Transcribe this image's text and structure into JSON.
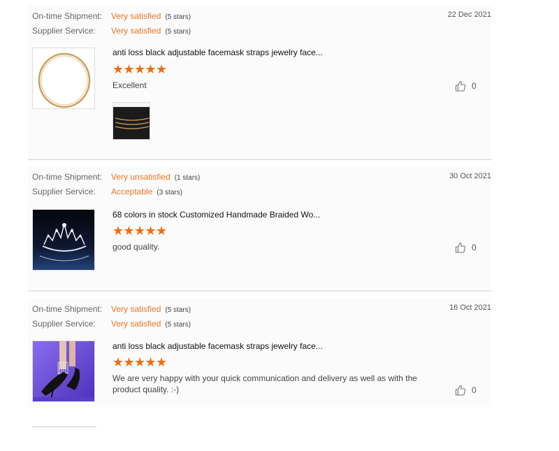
{
  "labels": {
    "shipment": "On-time Shipment:",
    "service": "Supplier Service:"
  },
  "reviews": [
    {
      "shipment_value": "Very satisfied",
      "shipment_count": "(5 stars)",
      "service_value": "Very satisfied",
      "service_count": "(5 stars)",
      "date": "22 Dec 2021",
      "product_title": "anti loss black adjustable facemask straps jewelry face...",
      "rating": 5,
      "comment": "Excellent",
      "likes": "0",
      "thumbnail_icon": "gold-chain-necklace-image",
      "photo_icon": "waist-chain-photo"
    },
    {
      "shipment_value": "Very unsatisfied",
      "shipment_count": "(1 stars)",
      "service_value": "Acceptable",
      "service_count": "(3 stars)",
      "date": "30 Oct 2021",
      "product_title": "68 colors in stock Customized Handmade Braided Wo...",
      "rating": 5,
      "comment": "good quality.",
      "likes": "0",
      "thumbnail_icon": "tiara-crown-image"
    },
    {
      "shipment_value": "Very satisfied",
      "shipment_count": "(5 stars)",
      "service_value": "Very satisfied",
      "service_count": "(5 stars)",
      "date": "16 Oct 2021",
      "product_title": "anti loss black adjustable facemask straps jewelry face...",
      "rating": 5,
      "comment": "We are very happy with your quick communication and delivery as well as with the product quality. :-)",
      "likes": "0",
      "thumbnail_icon": "anklet-heels-image"
    }
  ],
  "colors": {
    "accent": "#e87722",
    "star": "#f06c11"
  }
}
